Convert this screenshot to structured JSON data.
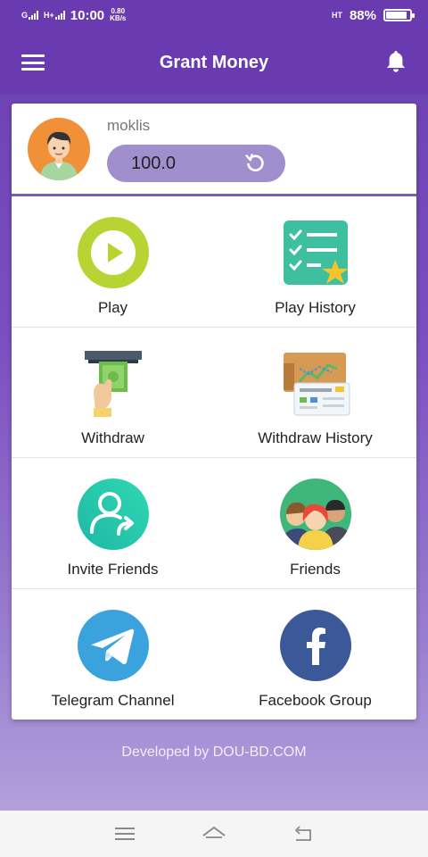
{
  "status_bar": {
    "network_left": "G",
    "network_right": "H+",
    "time": "10:00",
    "speed_value": "0.80",
    "speed_unit": "KB/s",
    "network_type": "HT",
    "battery": "88%",
    "battery_level": 0.88
  },
  "app_bar": {
    "title": "Grant Money",
    "menu_icon": "hamburger-menu-icon",
    "notification_icon": "bell-icon"
  },
  "profile": {
    "username": "moklis",
    "balance": "100.0",
    "refresh_icon": "refresh-icon"
  },
  "menu_items": [
    {
      "label": "Play",
      "icon": "play-icon"
    },
    {
      "label": "Play History",
      "icon": "checklist-star-icon"
    },
    {
      "label": "Withdraw",
      "icon": "atm-cash-icon"
    },
    {
      "label": "Withdraw History",
      "icon": "history-board-icon"
    },
    {
      "label": "Invite Friends",
      "icon": "add-user-arrow-icon"
    },
    {
      "label": "Friends",
      "icon": "friends-group-icon"
    },
    {
      "label": "Telegram Channel",
      "icon": "telegram-icon"
    },
    {
      "label": "Facebook Group",
      "icon": "facebook-icon"
    }
  ],
  "footer": {
    "text": "Developed by DOU-BD.COM"
  },
  "nav_bar": {
    "menu": "recent-apps-icon",
    "home": "home-icon",
    "back": "back-icon"
  },
  "colors": {
    "primary": "#6a3ab1",
    "balance_pill": "#a08fcc",
    "play_green": "#b8d432",
    "checklist_teal": "#3dbfa0",
    "invite_teal": "#21c3a8",
    "telegram_blue": "#3aa3dd",
    "facebook_blue": "#3b5998"
  }
}
